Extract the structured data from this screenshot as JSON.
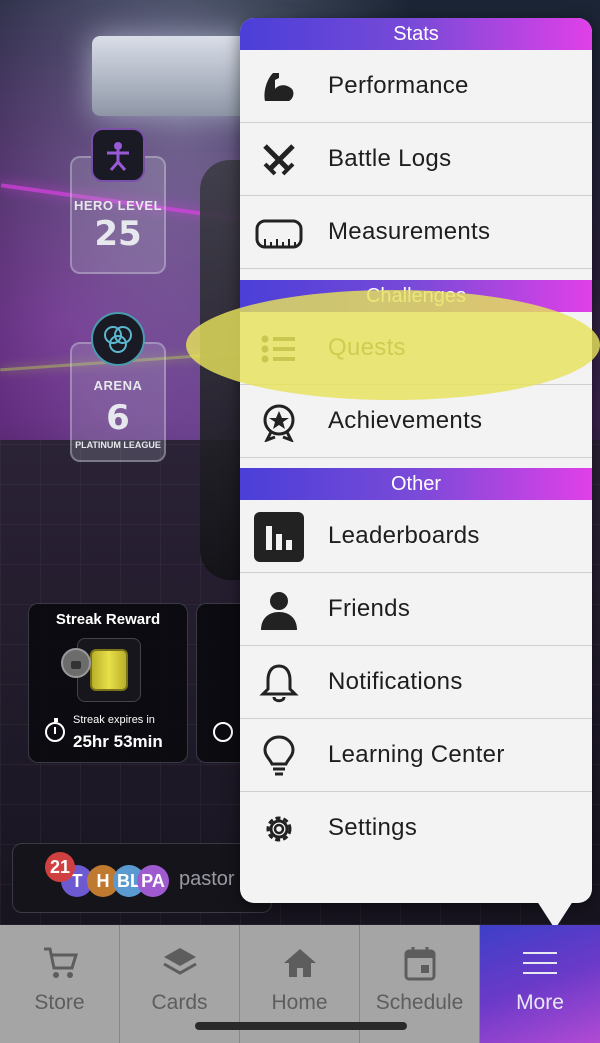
{
  "game": {
    "hero_level": {
      "label": "HERO LEVEL",
      "value": "25"
    },
    "arena": {
      "label": "ARENA",
      "value": "6",
      "league": "PLATINUM LEAGUE"
    },
    "streak": {
      "title": "Streak Reward",
      "expires_label": "Streak expires in",
      "time_left": "25hr 53min"
    },
    "user_bar": {
      "count": "21",
      "avatars": [
        "T",
        "H",
        "BL",
        "PA"
      ],
      "username": "pastor"
    }
  },
  "menu": {
    "sections": [
      {
        "header": "Stats",
        "items": [
          {
            "label": "Performance",
            "icon": "flexed-arm-icon"
          },
          {
            "label": "Battle Logs",
            "icon": "crossed-swords-icon"
          },
          {
            "label": "Measurements",
            "icon": "tape-measure-icon"
          }
        ]
      },
      {
        "header": "Challenges",
        "items": [
          {
            "label": "Quests",
            "icon": "list-icon",
            "highlighted": true
          },
          {
            "label": "Achievements",
            "icon": "star-badge-icon"
          }
        ]
      },
      {
        "header": "Other",
        "items": [
          {
            "label": "Leaderboards",
            "icon": "bar-chart-icon"
          },
          {
            "label": "Friends",
            "icon": "person-icon"
          },
          {
            "label": "Notifications",
            "icon": "bell-icon"
          },
          {
            "label": "Learning Center",
            "icon": "lightbulb-icon"
          },
          {
            "label": "Settings",
            "icon": "gear-icon"
          }
        ]
      }
    ]
  },
  "tabbar": {
    "tabs": [
      {
        "label": "Store",
        "icon": "cart-icon"
      },
      {
        "label": "Cards",
        "icon": "layers-icon"
      },
      {
        "label": "Home",
        "icon": "home-icon"
      },
      {
        "label": "Schedule",
        "icon": "calendar-icon"
      },
      {
        "label": "More",
        "icon": "hamburger-icon",
        "active": true
      }
    ]
  },
  "colors": {
    "section_header_gradient": [
      "#4a3fd8",
      "#e040e8"
    ],
    "active_tab_gradient": [
      "#3d3fc8",
      "#b14bd4"
    ],
    "highlight": "#e6e25a"
  }
}
